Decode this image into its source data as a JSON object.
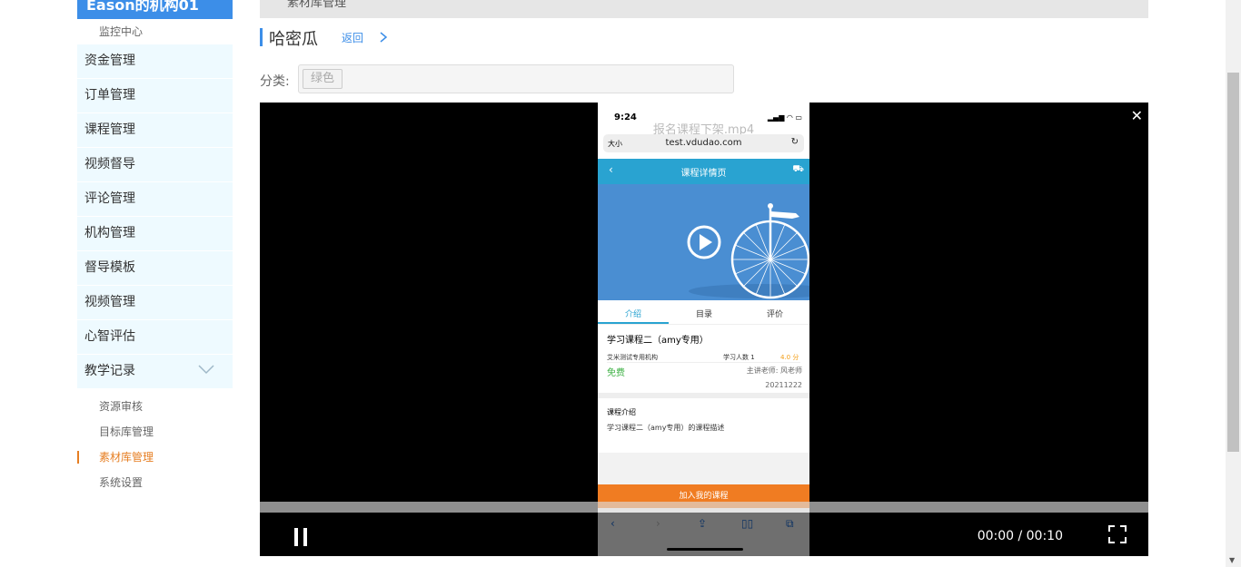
{
  "sidebar": {
    "header": "Eason的机构01",
    "top_sub": "监控中心",
    "items": [
      "资金管理",
      "订单管理",
      "课程管理",
      "视频督导",
      "评论管理",
      "机构管理",
      "督导模板",
      "视频管理",
      "心智评估",
      "教学记录"
    ],
    "sub_items": [
      "资源审核",
      "目标库管理",
      "素材库管理",
      "系统设置"
    ],
    "active_sub": "素材库管理"
  },
  "topbar": {
    "label": "素材库管理"
  },
  "page": {
    "title": "哈密瓜",
    "back": "返回"
  },
  "category": {
    "label": "分类:",
    "tag": "绿色"
  },
  "video": {
    "filename": "报名课程下架.mp4",
    "time": "00:00 / 00:10",
    "progress": 0.0,
    "phone": {
      "status_time": "9:24",
      "url_size": "大小",
      "url": "test.vdudao.com",
      "nav_title": "课程详情页",
      "tabs": [
        "介绍",
        "目录",
        "评价"
      ],
      "course_title": "学习课程二（amy专用）",
      "org": "艾米测试专用机构",
      "students": "学习人数 1",
      "rating": "4.0 分",
      "price": "免费",
      "teacher": "主讲老师: 风老师",
      "date": "20211222",
      "intro_heading": "课程介绍",
      "intro_text": "学习课程二（amy专用）的课程描述",
      "join_button": "加入我的课程"
    }
  },
  "colors": {
    "accent": "#3c8ee8",
    "active": "#e67e22",
    "join": "#f07c22",
    "nav": "#29a3d1"
  }
}
